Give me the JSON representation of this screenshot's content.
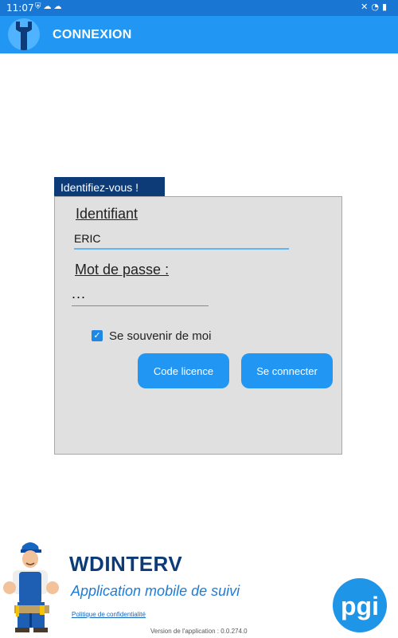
{
  "status_bar": {
    "time": "11:07",
    "left_icons": [
      "shield-icon",
      "cloud-icon",
      "cloud-icon"
    ],
    "right_icons": [
      "mute-icon",
      "wifi-icon",
      "battery-icon"
    ]
  },
  "app_bar": {
    "title": "CONNEXION",
    "logo_icon": "wrench-icon"
  },
  "login": {
    "tab_title": "Identifiez-vous !",
    "id_label": "Identifiant",
    "id_value": "ERIC",
    "password_label": "Mot de passe :",
    "password_value": "...",
    "remember_label": "Se souvenir de moi",
    "remember_checked": true,
    "licence_button": "Code licence",
    "connect_button": "Se connecter"
  },
  "footer": {
    "brand_name": "WDINTERV",
    "brand_subtitle": "Application mobile de suivi",
    "privacy_link": "Politique de confidentialité",
    "version": "Version de l'application : 0.0.274.0",
    "logo_text": "pgi"
  },
  "colors": {
    "status_bar": "#1976d2",
    "app_bar": "#2196f3",
    "tab": "#0d3b78",
    "panel": "#e0e0e0",
    "button": "#2196f3",
    "brand": "#0d3b78",
    "subtitle": "#1f7bd6"
  }
}
